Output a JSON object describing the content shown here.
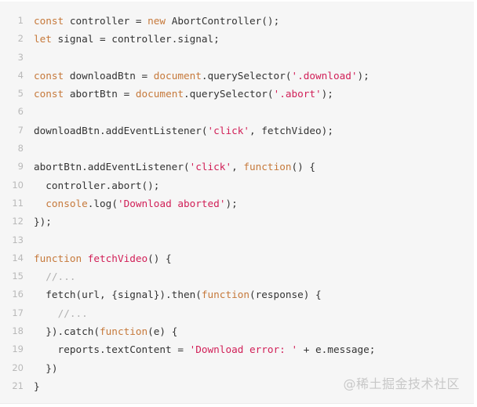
{
  "code_block": {
    "language": "javascript",
    "lines": [
      {
        "n": "1",
        "tokens": [
          {
            "t": "kw",
            "v": "const"
          },
          {
            "t": "plain",
            "v": " controller = "
          },
          {
            "t": "kw",
            "v": "new"
          },
          {
            "t": "plain",
            "v": " AbortController();"
          }
        ]
      },
      {
        "n": "2",
        "tokens": [
          {
            "t": "kw",
            "v": "let"
          },
          {
            "t": "plain",
            "v": " signal = controller.signal;"
          }
        ]
      },
      {
        "n": "3",
        "tokens": []
      },
      {
        "n": "4",
        "tokens": [
          {
            "t": "kw",
            "v": "const"
          },
          {
            "t": "plain",
            "v": " downloadBtn = "
          },
          {
            "t": "builtin",
            "v": "document"
          },
          {
            "t": "plain",
            "v": ".querySelector("
          },
          {
            "t": "str",
            "v": "'.download'"
          },
          {
            "t": "plain",
            "v": ");"
          }
        ]
      },
      {
        "n": "5",
        "tokens": [
          {
            "t": "kw",
            "v": "const"
          },
          {
            "t": "plain",
            "v": " abortBtn = "
          },
          {
            "t": "builtin",
            "v": "document"
          },
          {
            "t": "plain",
            "v": ".querySelector("
          },
          {
            "t": "str",
            "v": "'.abort'"
          },
          {
            "t": "plain",
            "v": ");"
          }
        ]
      },
      {
        "n": "6",
        "tokens": []
      },
      {
        "n": "7",
        "tokens": [
          {
            "t": "plain",
            "v": "downloadBtn.addEventListener("
          },
          {
            "t": "str",
            "v": "'click'"
          },
          {
            "t": "plain",
            "v": ", fetchVideo);"
          }
        ]
      },
      {
        "n": "8",
        "tokens": []
      },
      {
        "n": "9",
        "tokens": [
          {
            "t": "plain",
            "v": "abortBtn.addEventListener("
          },
          {
            "t": "str",
            "v": "'click'"
          },
          {
            "t": "plain",
            "v": ", "
          },
          {
            "t": "kw",
            "v": "function"
          },
          {
            "t": "plain",
            "v": "() {"
          }
        ]
      },
      {
        "n": "10",
        "tokens": [
          {
            "t": "plain",
            "v": "  controller.abort();"
          }
        ]
      },
      {
        "n": "11",
        "tokens": [
          {
            "t": "plain",
            "v": "  "
          },
          {
            "t": "builtin",
            "v": "console"
          },
          {
            "t": "plain",
            "v": ".log("
          },
          {
            "t": "str",
            "v": "'Download aborted'"
          },
          {
            "t": "plain",
            "v": ");"
          }
        ]
      },
      {
        "n": "12",
        "tokens": [
          {
            "t": "plain",
            "v": "});"
          }
        ]
      },
      {
        "n": "13",
        "tokens": []
      },
      {
        "n": "14",
        "tokens": [
          {
            "t": "kw",
            "v": "function"
          },
          {
            "t": "plain",
            "v": " "
          },
          {
            "t": "fn",
            "v": "fetchVideo"
          },
          {
            "t": "plain",
            "v": "() {"
          }
        ]
      },
      {
        "n": "15",
        "tokens": [
          {
            "t": "plain",
            "v": "  "
          },
          {
            "t": "comment",
            "v": "//..."
          }
        ]
      },
      {
        "n": "16",
        "tokens": [
          {
            "t": "plain",
            "v": "  fetch(url, {signal}).then("
          },
          {
            "t": "kw",
            "v": "function"
          },
          {
            "t": "plain",
            "v": "(response) {"
          }
        ]
      },
      {
        "n": "17",
        "tokens": [
          {
            "t": "plain",
            "v": "    "
          },
          {
            "t": "comment",
            "v": "//..."
          }
        ]
      },
      {
        "n": "18",
        "tokens": [
          {
            "t": "plain",
            "v": "  }).catch("
          },
          {
            "t": "kw",
            "v": "function"
          },
          {
            "t": "plain",
            "v": "(e) {"
          }
        ]
      },
      {
        "n": "19",
        "tokens": [
          {
            "t": "plain",
            "v": "    reports.textContent = "
          },
          {
            "t": "str",
            "v": "'Download error: '"
          },
          {
            "t": "plain",
            "v": " + e.message;"
          }
        ]
      },
      {
        "n": "20",
        "tokens": [
          {
            "t": "plain",
            "v": "  })"
          }
        ]
      },
      {
        "n": "21",
        "tokens": [
          {
            "t": "plain",
            "v": "}"
          }
        ]
      }
    ]
  },
  "watermark": "@稀土掘金技术社区",
  "colors": {
    "background": "#f6f6f6",
    "keyword": "#c6793b",
    "string": "#d11f57",
    "line_number": "#b9b9b9",
    "text": "#333333",
    "comment": "#b0b0b0"
  }
}
